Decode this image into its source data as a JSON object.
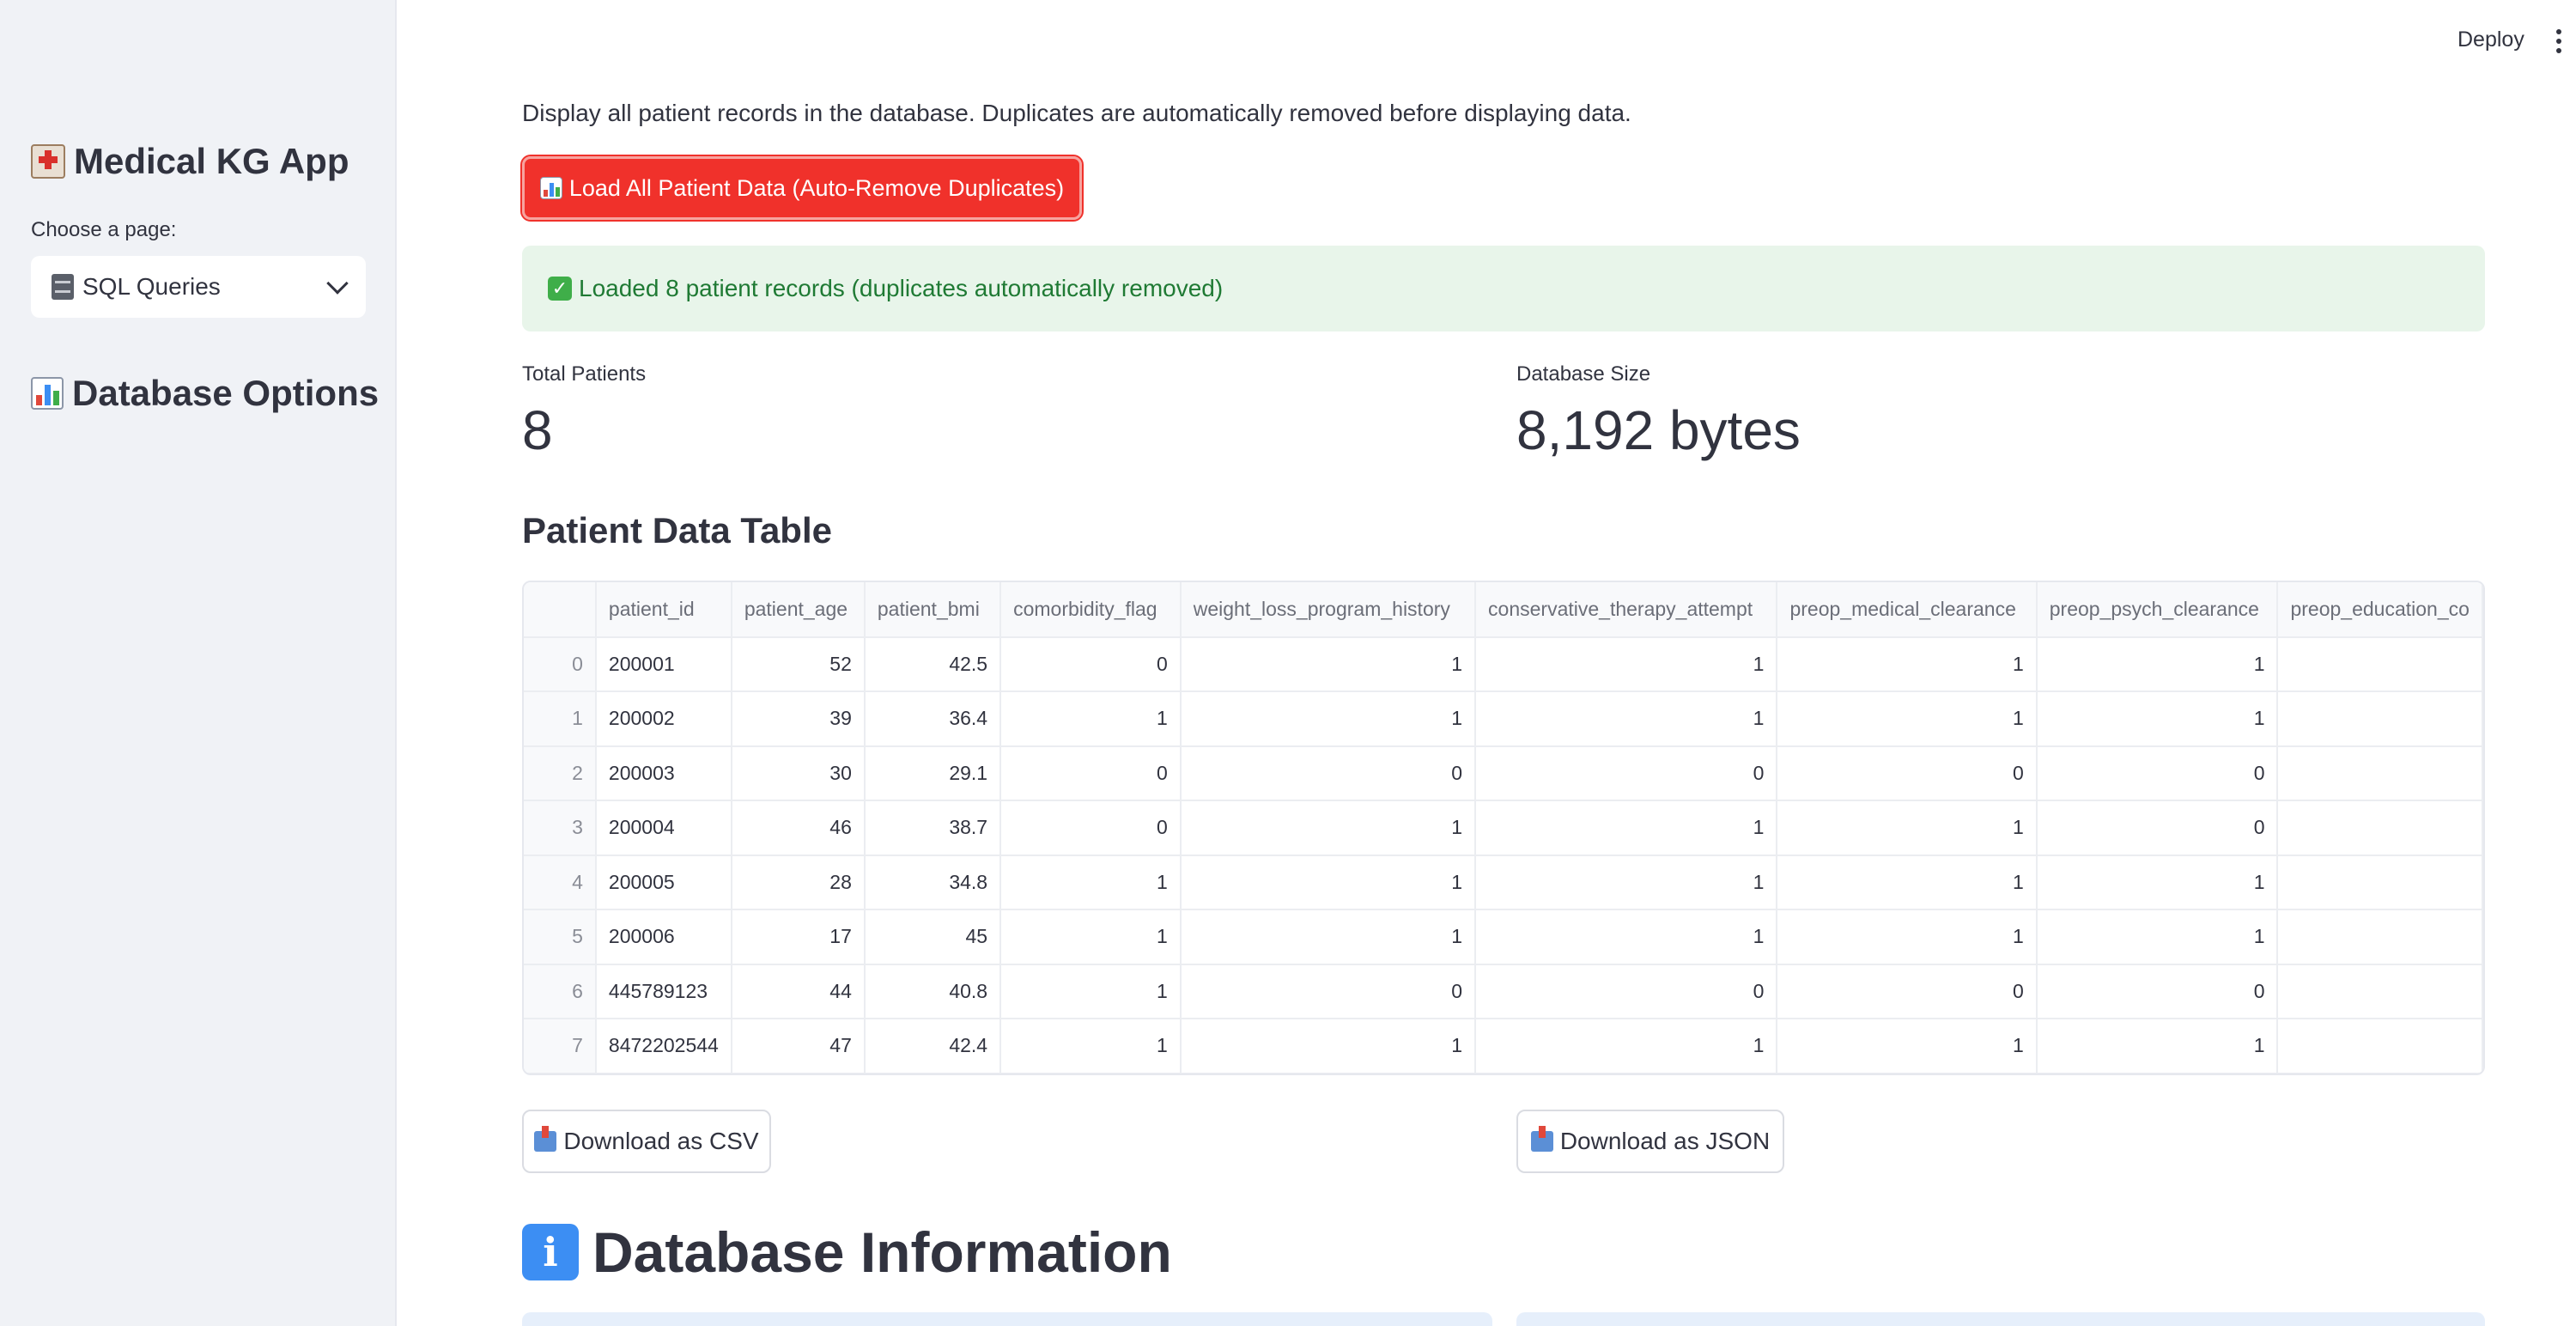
{
  "sidebar": {
    "title": "Medical KG App",
    "choose_label": "Choose a page:",
    "selected_page": "SQL Queries",
    "options_title": "Database Options"
  },
  "header": {
    "deploy_label": "Deploy"
  },
  "main": {
    "description": "Display all patient records in the database. Duplicates are automatically removed before displaying data.",
    "load_button": "Load All Patient Data (Auto-Remove Duplicates)",
    "success_message": "Loaded 8 patient records (duplicates automatically removed)",
    "metrics": [
      {
        "label": "Total Patients",
        "value": "8"
      },
      {
        "label": "Database Size",
        "value": "8,192 bytes"
      }
    ],
    "table_title": "Patient Data Table",
    "table": {
      "columns": [
        "",
        "patient_id",
        "patient_age",
        "patient_bmi",
        "comorbidity_flag",
        "weight_loss_program_history",
        "conservative_therapy_attempt",
        "preop_medical_clearance",
        "preop_psych_clearance",
        "preop_education_co"
      ],
      "rows": [
        [
          "0",
          "200001",
          "52",
          "42.5",
          "0",
          "1",
          "1",
          "1",
          "1",
          ""
        ],
        [
          "1",
          "200002",
          "39",
          "36.4",
          "1",
          "1",
          "1",
          "1",
          "1",
          ""
        ],
        [
          "2",
          "200003",
          "30",
          "29.1",
          "0",
          "0",
          "0",
          "0",
          "0",
          ""
        ],
        [
          "3",
          "200004",
          "46",
          "38.7",
          "0",
          "1",
          "1",
          "1",
          "0",
          ""
        ],
        [
          "4",
          "200005",
          "28",
          "34.8",
          "1",
          "1",
          "1",
          "1",
          "1",
          ""
        ],
        [
          "5",
          "200006",
          "17",
          "45",
          "1",
          "1",
          "1",
          "1",
          "1",
          ""
        ],
        [
          "6",
          "445789123",
          "44",
          "40.8",
          "1",
          "0",
          "0",
          "0",
          "0",
          ""
        ],
        [
          "7",
          "8472202544",
          "47",
          "42.4",
          "1",
          "1",
          "1",
          "1",
          "1",
          ""
        ]
      ]
    },
    "download_csv": "Download as CSV",
    "download_json": "Download as JSON",
    "info_title": "Database Information"
  },
  "colors": {
    "primary_button": "#f0312b",
    "success_bg": "#e8f5ea",
    "success_text": "#1f7a34",
    "sidebar_bg": "#f0f2f6",
    "info_bg": "#e6effb"
  },
  "icons": {
    "app": "hospital-icon",
    "page": "file-cabinet-icon",
    "options": "bar-chart-icon",
    "load": "bar-chart-icon",
    "success": "check-mark-icon",
    "download": "inbox-tray-icon",
    "info": "information-icon"
  }
}
